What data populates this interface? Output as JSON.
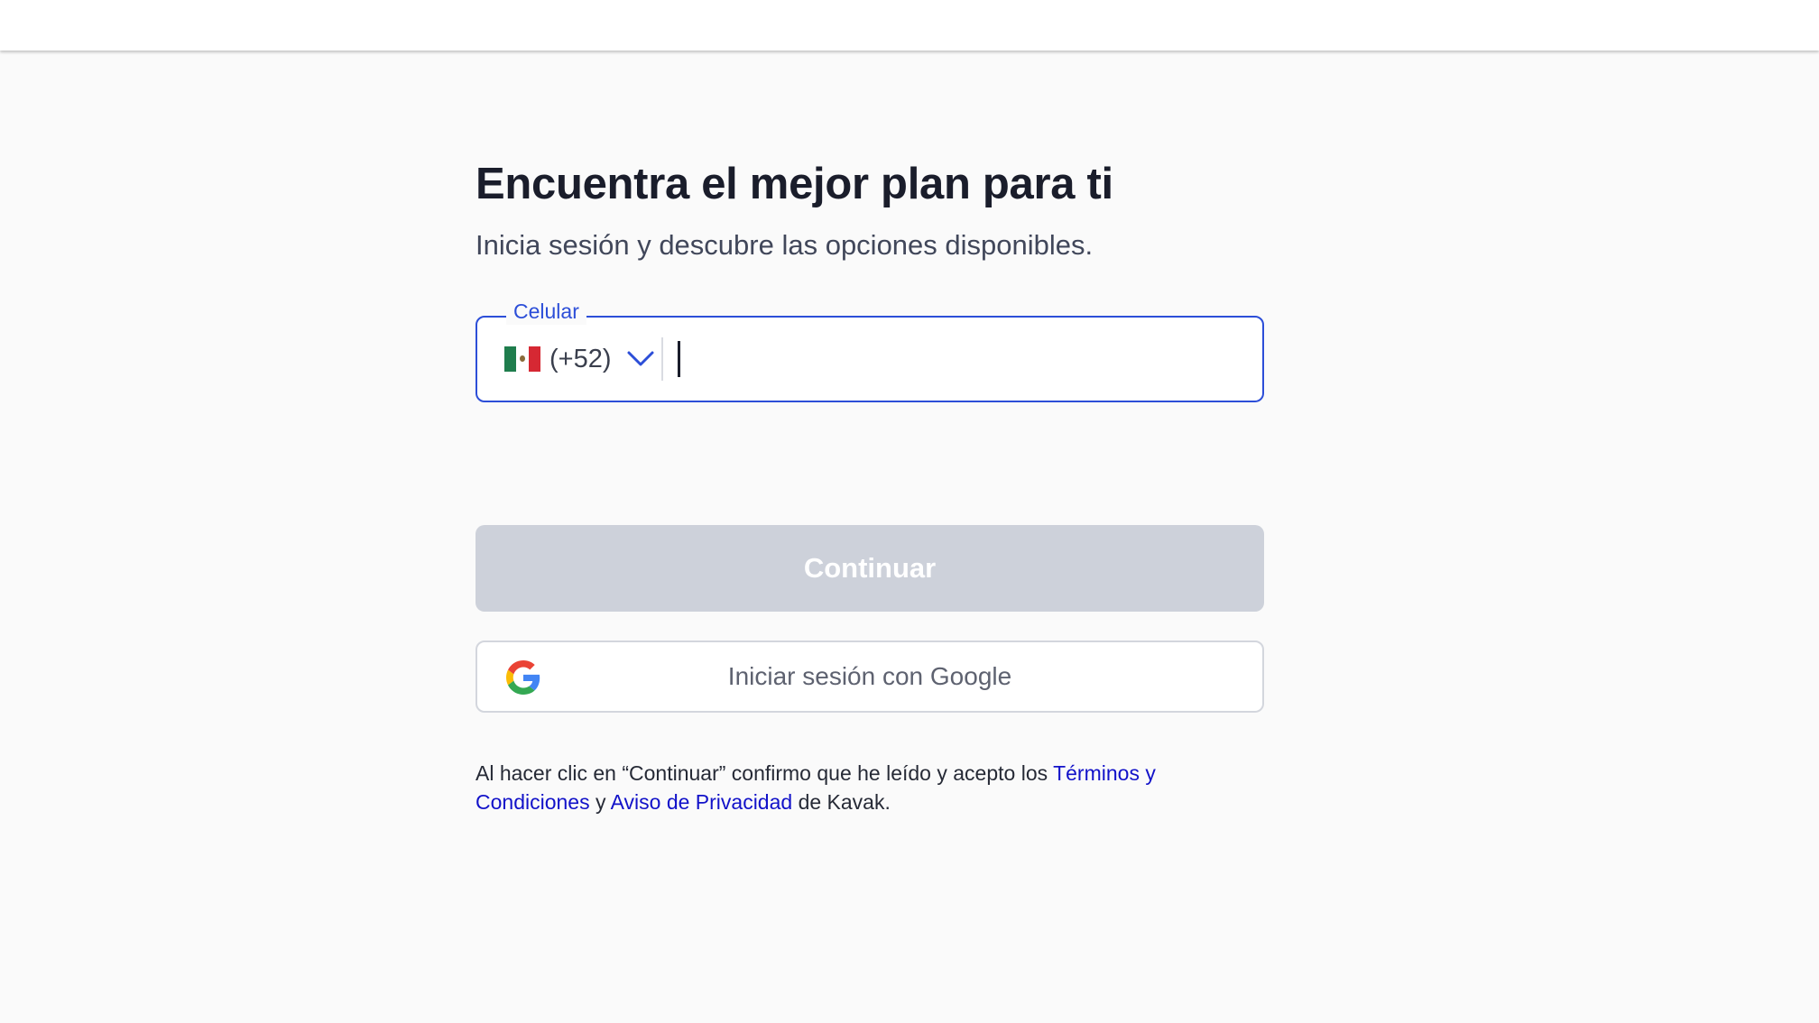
{
  "page": {
    "title": "Encuentra el mejor plan para ti",
    "subtitle": "Inicia sesión y descubre las opciones disponibles."
  },
  "phone_field": {
    "label": "Celular",
    "country_flag": "mexico-flag-icon",
    "dial_code": "(+52)",
    "value": "",
    "placeholder": "",
    "accent_color": "#2c4ed8"
  },
  "continue_button": {
    "label": "Continuar",
    "state": "disabled",
    "background": "#cdd1da"
  },
  "google_button": {
    "label": "Iniciar sesión con Google",
    "icon": "google-icon"
  },
  "legal": {
    "prefix": "Al hacer clic en “Continuar” confirmo que he leído y acepto los ",
    "terms_link": "Términos y Condiciones",
    "connector": " y ",
    "privacy_link": "Aviso de Privacidad",
    "suffix": " de Kavak.",
    "link_color": "#1212c9"
  }
}
